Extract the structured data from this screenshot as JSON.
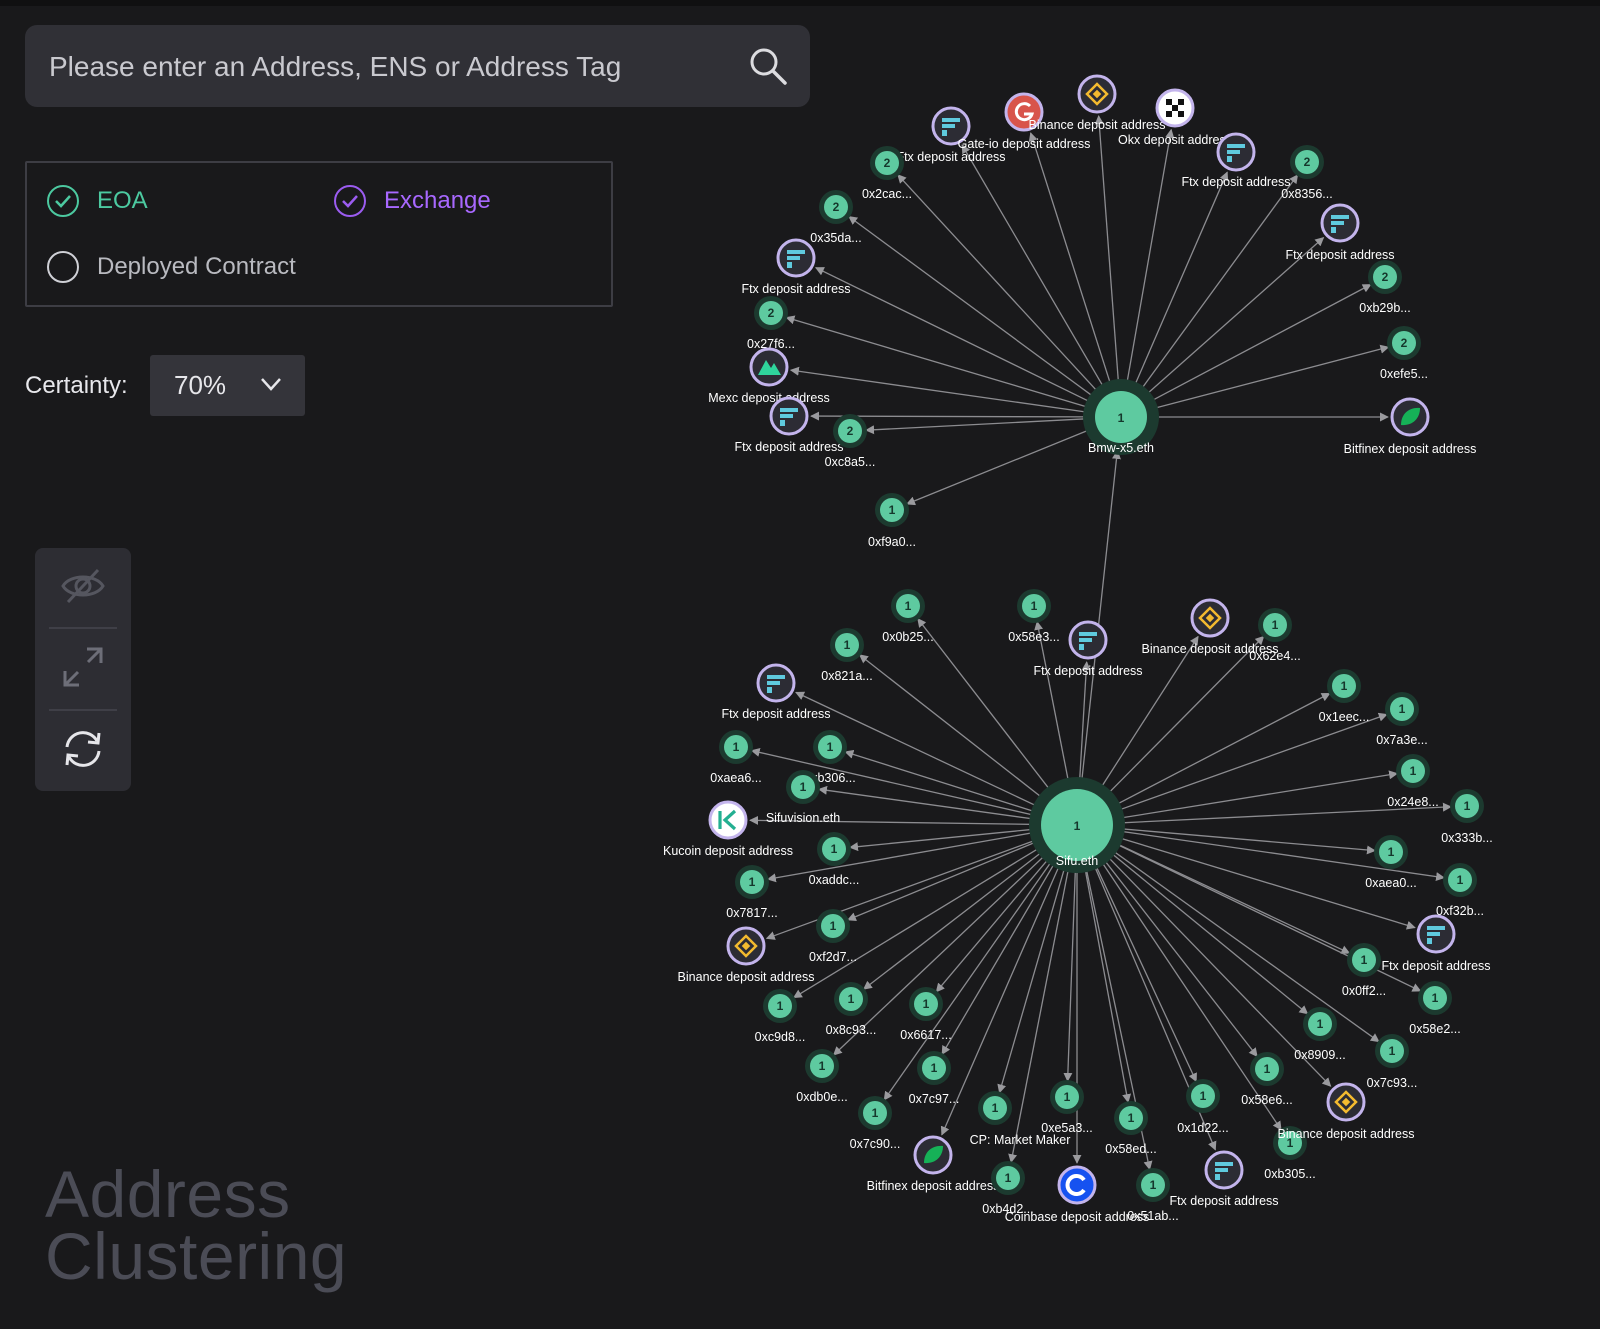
{
  "search": {
    "placeholder": "Please enter an Address, ENS or Address Tag",
    "icon": "search-icon"
  },
  "filters": {
    "eoa": {
      "label": "EOA",
      "checked": true,
      "color": "#4cc9a0"
    },
    "exchange": {
      "label": "Exchange",
      "checked": true,
      "color": "#a868ff"
    },
    "deployed_contract": {
      "label": "Deployed Contract",
      "checked": false
    }
  },
  "certainty": {
    "label": "Certainty:",
    "value": "70%"
  },
  "toolbar": {
    "icons": [
      "eye-off-icon",
      "expand-icon",
      "refresh-icon"
    ]
  },
  "watermark": {
    "line1": "Address",
    "line2": "Clustering"
  },
  "colors": {
    "eoa_node": "#5ecaa0",
    "exchange_ring": "#c3b4ec",
    "edge": "#8c8c90"
  },
  "graph": {
    "hubs": [
      {
        "id": "bmw",
        "label": "Bmw-x5.eth",
        "count": "1"
      },
      {
        "id": "sifu",
        "label": "Sifu.eth",
        "count": "1"
      }
    ],
    "nodes": [
      {
        "label": "Ftx deposit address",
        "type": "ftx"
      },
      {
        "label": "Gate-io deposit address",
        "type": "gate"
      },
      {
        "label": "Binance deposit address",
        "type": "binance"
      },
      {
        "label": "Okx deposit address",
        "type": "okx"
      },
      {
        "label": "Ftx deposit address",
        "type": "ftx"
      },
      {
        "label": "0x8356...",
        "type": "eoa",
        "count": "2"
      },
      {
        "label": "Ftx deposit address",
        "type": "ftx"
      },
      {
        "label": "0xb29b...",
        "type": "eoa",
        "count": "2"
      },
      {
        "label": "0xefe5...",
        "type": "eoa",
        "count": "2"
      },
      {
        "label": "Bitfinex deposit address",
        "type": "bitfinex"
      },
      {
        "label": "0x2cac...",
        "type": "eoa",
        "count": "2"
      },
      {
        "label": "0x35da...",
        "type": "eoa",
        "count": "2"
      },
      {
        "label": "Ftx deposit address",
        "type": "ftx"
      },
      {
        "label": "0x27f6...",
        "type": "eoa",
        "count": "2"
      },
      {
        "label": "Mexc deposit address",
        "type": "mexc"
      },
      {
        "label": "Ftx deposit address",
        "type": "ftx"
      },
      {
        "label": "0xc8a5...",
        "type": "eoa",
        "count": "2"
      },
      {
        "label": "0xf9a0...",
        "type": "eoa",
        "count": "1"
      },
      {
        "label": "0x0b25...",
        "type": "eoa",
        "count": "1"
      },
      {
        "label": "0x58e3...",
        "type": "eoa",
        "count": "1"
      },
      {
        "label": "Ftx deposit address",
        "type": "ftx"
      },
      {
        "label": "Binance deposit address",
        "type": "binance"
      },
      {
        "label": "0x62e4...",
        "type": "eoa",
        "count": "1"
      },
      {
        "label": "0x821a...",
        "type": "eoa",
        "count": "1"
      },
      {
        "label": "Ftx deposit address",
        "type": "ftx"
      },
      {
        "label": "0xaea6...",
        "type": "eoa",
        "count": "1"
      },
      {
        "label": "0xb306...",
        "type": "eoa",
        "count": "1"
      },
      {
        "label": "Sifuvision.eth",
        "type": "eoa",
        "count": "1"
      },
      {
        "label": "Kucoin deposit address",
        "type": "kucoin"
      },
      {
        "label": "0xaddc...",
        "type": "eoa",
        "count": "1"
      },
      {
        "label": "0x7817...",
        "type": "eoa",
        "count": "1"
      },
      {
        "label": "0xf2d7...",
        "type": "eoa",
        "count": "1"
      },
      {
        "label": "Binance deposit address",
        "type": "binance"
      },
      {
        "label": "0xc9d8...",
        "type": "eoa",
        "count": "1"
      },
      {
        "label": "0x8c93...",
        "type": "eoa",
        "count": "1"
      },
      {
        "label": "0x6617...",
        "type": "eoa",
        "count": "1"
      },
      {
        "label": "0xdb0e...",
        "type": "eoa",
        "count": "1"
      },
      {
        "label": "0x7c97...",
        "type": "eoa",
        "count": "1"
      },
      {
        "label": "0x7c90...",
        "type": "eoa",
        "count": "1"
      },
      {
        "label": "CP: Market Maker",
        "type": "eoa",
        "count": "1"
      },
      {
        "label": "Bitfinex deposit address",
        "type": "bitfinex"
      },
      {
        "label": "0xb4d2...",
        "type": "eoa",
        "count": "1"
      },
      {
        "label": "0xe5a3...",
        "type": "eoa",
        "count": "1"
      },
      {
        "label": "Coinbase deposit address",
        "type": "coinbase"
      },
      {
        "label": "0x58ed...",
        "type": "eoa",
        "count": "1"
      },
      {
        "label": "0x51ab...",
        "type": "eoa",
        "count": "1"
      },
      {
        "label": "0x1d22...",
        "type": "eoa",
        "count": "1"
      },
      {
        "label": "Ftx deposit address",
        "type": "ftx"
      },
      {
        "label": "0x58e6...",
        "type": "eoa",
        "count": "1"
      },
      {
        "label": "0xb305...",
        "type": "eoa",
        "count": "1"
      },
      {
        "label": "Binance deposit address",
        "type": "binance"
      },
      {
        "label": "0x8909...",
        "type": "eoa",
        "count": "1"
      },
      {
        "label": "0x7c93...",
        "type": "eoa",
        "count": "1"
      },
      {
        "label": "0x0ff2...",
        "type": "eoa",
        "count": "1"
      },
      {
        "label": "0x58e2...",
        "type": "eoa",
        "count": "1"
      },
      {
        "label": "Ftx deposit address",
        "type": "ftx"
      },
      {
        "label": "0xf32b...",
        "type": "eoa",
        "count": "1"
      },
      {
        "label": "0xaea0...",
        "type": "eoa",
        "count": "1"
      },
      {
        "label": "0x333b...",
        "type": "eoa",
        "count": "1"
      },
      {
        "label": "0x24e8...",
        "type": "eoa",
        "count": "1"
      },
      {
        "label": "0x7a3e...",
        "type": "eoa",
        "count": "1"
      },
      {
        "label": "0x1eec...",
        "type": "eoa",
        "count": "1"
      }
    ]
  }
}
